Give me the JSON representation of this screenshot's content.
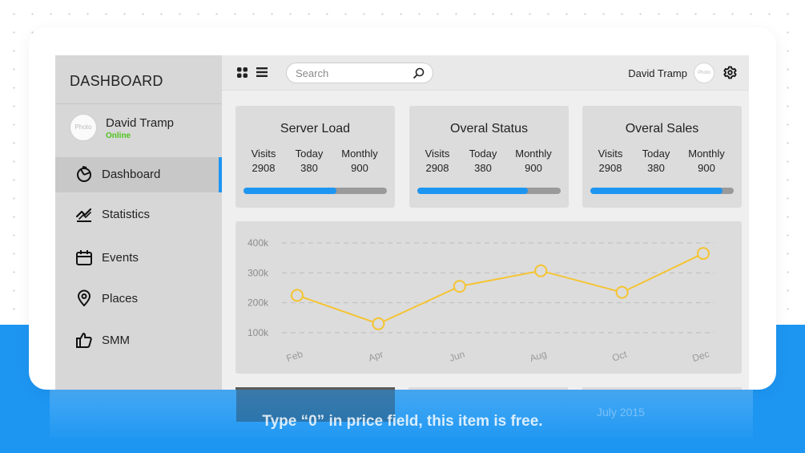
{
  "sidebar": {
    "title": "DASHBOARD",
    "profile": {
      "avatar_text": "Photo",
      "name": "David Tramp",
      "status": "Online"
    },
    "items": [
      {
        "label": "Dashboard",
        "icon": "dashboard-icon",
        "active": true
      },
      {
        "label": "Statistics",
        "icon": "statistics-icon",
        "active": false
      },
      {
        "label": "Events",
        "icon": "events-icon",
        "active": false
      },
      {
        "label": "Places",
        "icon": "places-icon",
        "active": false
      },
      {
        "label": "SMM",
        "icon": "thumbs-up-icon",
        "active": false
      }
    ]
  },
  "topbar": {
    "search_placeholder": "Search",
    "user_name": "David Tramp",
    "avatar_text": "Photo"
  },
  "cards": [
    {
      "title": "Server Load",
      "stats": [
        {
          "label": "Visits",
          "value": "2908"
        },
        {
          "label": "Today",
          "value": "380"
        },
        {
          "label": "Monthly",
          "value": "900"
        }
      ],
      "progress": 0.65
    },
    {
      "title": "Overal Status",
      "stats": [
        {
          "label": "Visits",
          "value": "2908"
        },
        {
          "label": "Today",
          "value": "380"
        },
        {
          "label": "Monthly",
          "value": "900"
        }
      ],
      "progress": 0.77
    },
    {
      "title": "Overal Sales",
      "stats": [
        {
          "label": "Visits",
          "value": "2908"
        },
        {
          "label": "Today",
          "value": "380"
        },
        {
          "label": "Monthly",
          "value": "900"
        }
      ],
      "progress": 0.92
    }
  ],
  "chart_data": {
    "type": "line",
    "categories": [
      "Feb",
      "Apr",
      "Jun",
      "Aug",
      "Oct",
      "Dec"
    ],
    "values": [
      225000,
      130000,
      255000,
      307000,
      235000,
      365000
    ],
    "y_ticks": [
      "400k",
      "300k",
      "200k",
      "100k"
    ],
    "ylim": [
      100000,
      400000
    ],
    "grid": true,
    "color": "#f5c432"
  },
  "bottom": {
    "date_label": "July 2015"
  },
  "caption": "Type “0” in price field, this item is free.",
  "colors": {
    "accent": "#1d96f2",
    "online": "#4fc41f",
    "line": "#f5c432"
  }
}
